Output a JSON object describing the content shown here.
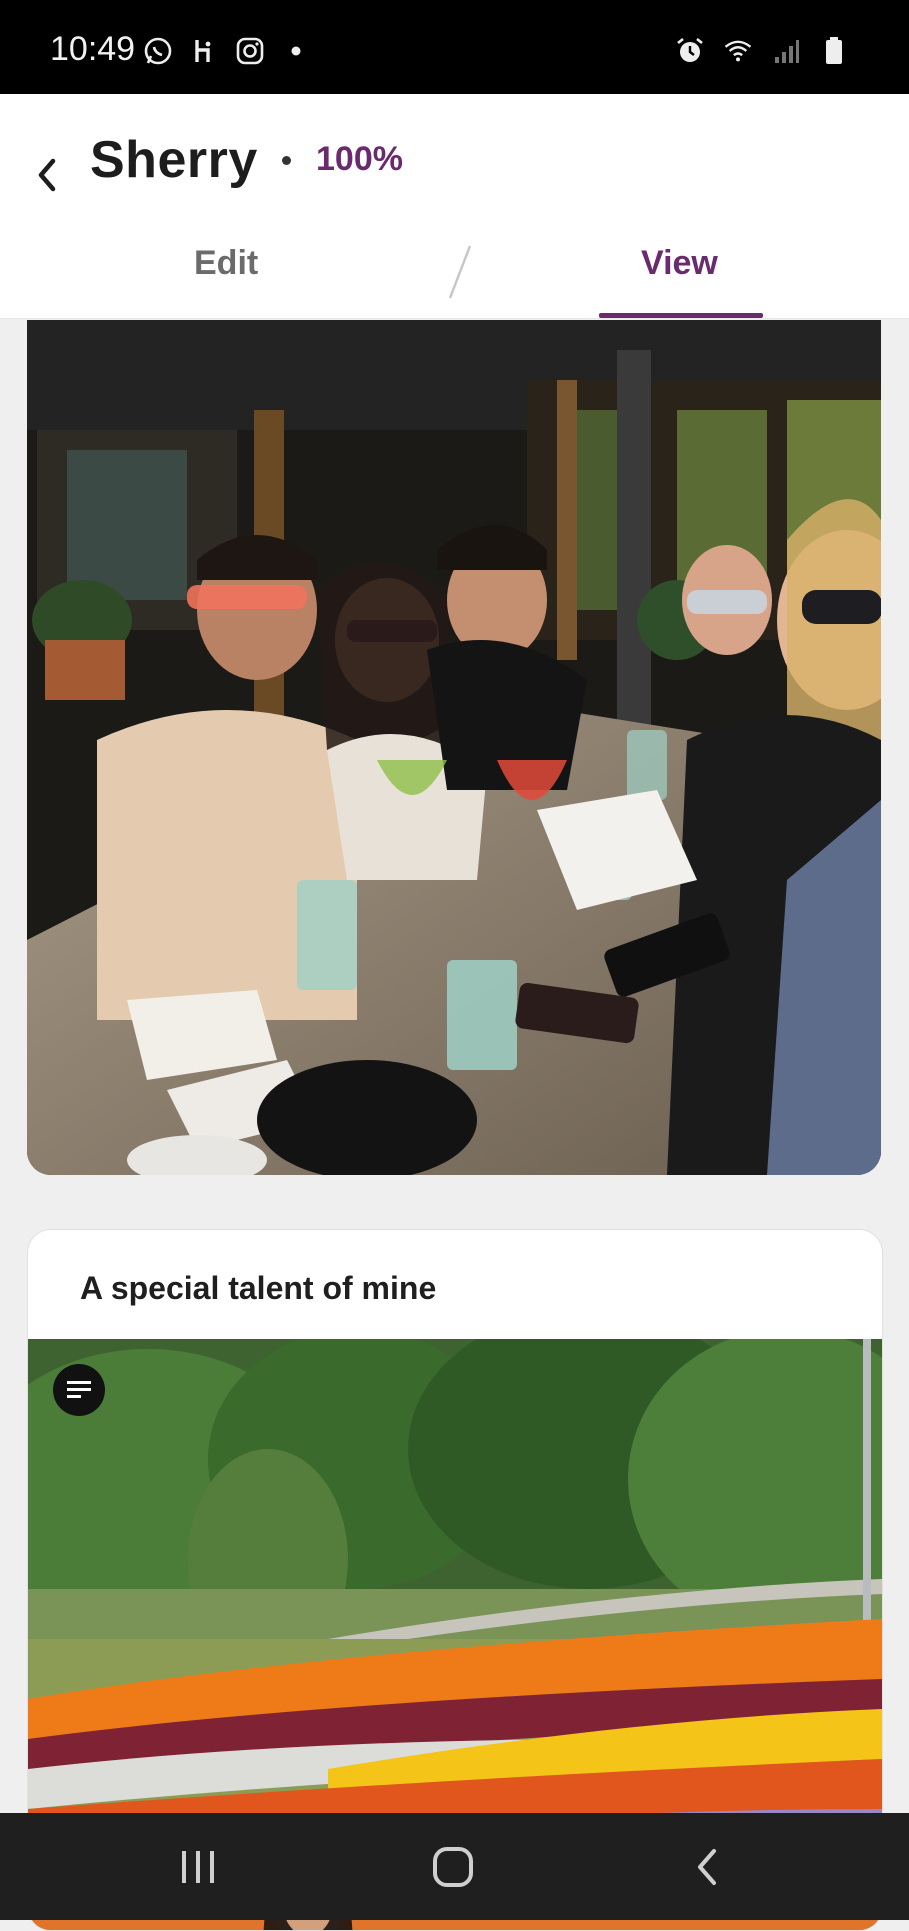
{
  "status_bar": {
    "time": "10:49",
    "left_icons": [
      "whatsapp-icon",
      "hinge-icon",
      "instagram-icon",
      "dot-icon"
    ],
    "right_icons": [
      "alarm-icon",
      "wifi-icon",
      "signal-icon",
      "battery-icon"
    ]
  },
  "header": {
    "title": "Sherry",
    "percent": "100%",
    "tabs": [
      {
        "label": "Edit",
        "active": false
      },
      {
        "label": "View",
        "active": true
      }
    ]
  },
  "content": {
    "photo1": {
      "description": "Group of friends at restaurant table"
    },
    "prompt": {
      "title": "A special talent of mine"
    }
  },
  "colors": {
    "accent": "#6a2a6e",
    "statusbar": "#000000",
    "navbar": "#1f1f1f",
    "background": "#efefef"
  },
  "navbar": {
    "buttons": [
      "recent-apps",
      "home",
      "back"
    ]
  }
}
